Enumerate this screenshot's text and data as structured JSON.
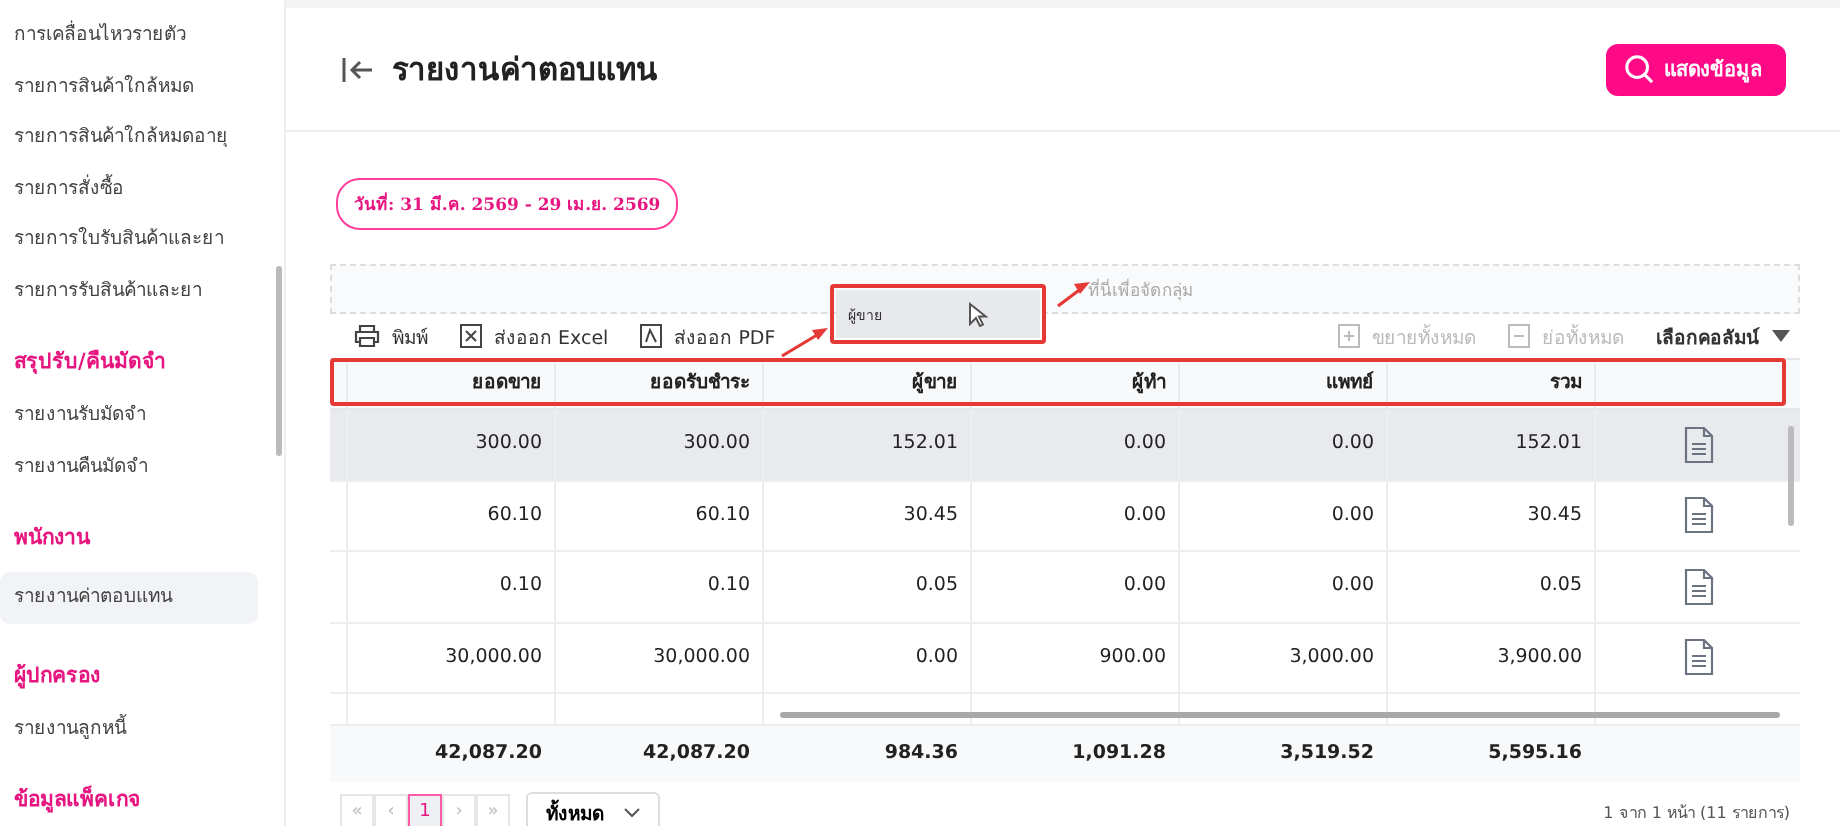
{
  "sidebar": {
    "items": [
      {
        "kind": "link",
        "label": "การเคลื่อนไหวรายตัว",
        "selected": false
      },
      {
        "kind": "link",
        "label": "รายการสินค้าใกล้หมด",
        "selected": false
      },
      {
        "kind": "link",
        "label": "รายการสินค้าใกล้หมดอายุ",
        "selected": false
      },
      {
        "kind": "link",
        "label": "รายการสั่งซื้อ",
        "selected": false
      },
      {
        "kind": "link",
        "label": "รายการใบรับสินค้าและยา",
        "selected": false
      },
      {
        "kind": "link",
        "label": "รายการรับสินค้าและยา",
        "selected": false
      },
      {
        "kind": "section",
        "label": "สรุปรับ/คืนมัดจำ"
      },
      {
        "kind": "link",
        "label": "รายงานรับมัดจำ",
        "selected": false
      },
      {
        "kind": "link",
        "label": "รายงานคืนมัดจำ",
        "selected": false
      },
      {
        "kind": "section",
        "label": "พนักงาน"
      },
      {
        "kind": "link",
        "label": "รายงานค่าตอบแทน",
        "selected": true
      },
      {
        "kind": "section",
        "label": "ผู้ปกครอง"
      },
      {
        "kind": "link",
        "label": "รายงานลูกหนี้",
        "selected": false
      },
      {
        "kind": "section",
        "label": "ข้อมูลแพ็คเกจ"
      }
    ]
  },
  "header": {
    "title": "รายงานค่าตอบแทน",
    "show_button": "แสดงข้อมูล"
  },
  "date_range": "วันที่: 31 มี.ค. 2569 - 29 เม.ย. 2569",
  "group_panel": {
    "hint": "ที่นี่เพื่อจัดกลุ่ม",
    "dragged_column": "ผู้ขาย"
  },
  "toolbar": {
    "left": [
      {
        "kind": "print",
        "label": "พิมพ์"
      },
      {
        "kind": "excel",
        "label": "ส่งออก Excel"
      },
      {
        "kind": "pdf",
        "label": "ส่งออก PDF"
      }
    ],
    "right": [
      {
        "kind": "expand",
        "label": "ขยายทั้งหมด",
        "disabled": true
      },
      {
        "kind": "collapse",
        "label": "ย่อทั้งหมด",
        "disabled": true
      }
    ],
    "column_chooser": "เลือกคอลัมน์"
  },
  "table": {
    "columns": [
      "ยอดขาย",
      "ยอดรับชำระ",
      "ผู้ขาย",
      "ผู้ทำ",
      "แพทย์",
      "รวม"
    ],
    "rows": [
      {
        "selected": true,
        "cells": [
          "300.00",
          "300.00",
          "152.01",
          "0.00",
          "0.00",
          "152.01"
        ]
      },
      {
        "selected": false,
        "cells": [
          "60.10",
          "60.10",
          "30.45",
          "0.00",
          "0.00",
          "30.45"
        ]
      },
      {
        "selected": false,
        "cells": [
          "0.10",
          "0.10",
          "0.05",
          "0.00",
          "0.00",
          "0.05"
        ]
      },
      {
        "selected": false,
        "cells": [
          "30,000.00",
          "30,000.00",
          "0.00",
          "900.00",
          "3,000.00",
          "3,900.00"
        ]
      }
    ],
    "totals": [
      "42,087.20",
      "42,087.20",
      "984.36",
      "1,091.28",
      "3,519.52",
      "5,595.16"
    ]
  },
  "pager": {
    "first": "«",
    "prev": "‹",
    "pages": [
      {
        "label": "1",
        "selected": true
      }
    ],
    "next": "›",
    "last": "»",
    "page_size": "ทั้งหมด",
    "summary": "1 จาก 1 หน้า (11 รายการ)"
  }
}
